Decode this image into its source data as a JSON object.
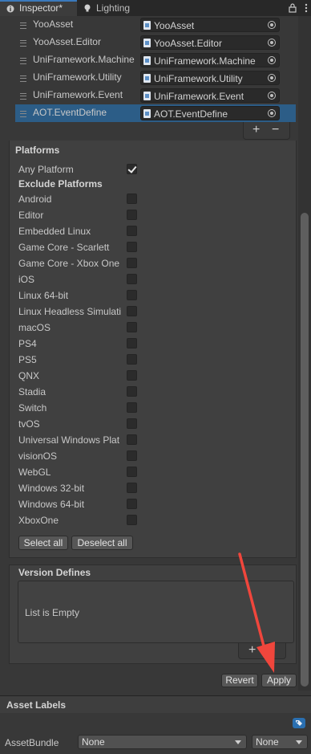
{
  "tabs": [
    {
      "label": "Inspector*",
      "icon": "info-icon",
      "active": true
    },
    {
      "label": "Lighting",
      "icon": "lightbulb-icon",
      "active": false
    }
  ],
  "tab_icons": [
    "lock-icon",
    "kebab-menu-icon"
  ],
  "references": [
    {
      "label": "YooAsset",
      "value": "YooAsset"
    },
    {
      "label": "YooAsset.Editor",
      "value": "YooAsset.Editor"
    },
    {
      "label": "UniFramework.Machine",
      "value": "UniFramework.Machine"
    },
    {
      "label": "UniFramework.Utility",
      "value": "UniFramework.Utility"
    },
    {
      "label": "UniFramework.Event",
      "value": "UniFramework.Event"
    },
    {
      "label": "AOT.EventDefine",
      "value": "AOT.EventDefine",
      "selected": true
    }
  ],
  "list_controls": {
    "add": "+",
    "remove": "−"
  },
  "platforms": {
    "title": "Platforms",
    "any_platform": {
      "label": "Any Platform",
      "checked": true
    },
    "exclude_title": "Exclude Platforms",
    "items": [
      {
        "label": "Android",
        "checked": false
      },
      {
        "label": "Editor",
        "checked": false
      },
      {
        "label": "Embedded Linux",
        "checked": false
      },
      {
        "label": "Game Core - Scarlett",
        "checked": false
      },
      {
        "label": "Game Core - Xbox One",
        "checked": false
      },
      {
        "label": "iOS",
        "checked": false
      },
      {
        "label": "Linux 64-bit",
        "checked": false
      },
      {
        "label": "Linux Headless Simulati",
        "checked": false
      },
      {
        "label": "macOS",
        "checked": false
      },
      {
        "label": "PS4",
        "checked": false
      },
      {
        "label": "PS5",
        "checked": false
      },
      {
        "label": "QNX",
        "checked": false
      },
      {
        "label": "Stadia",
        "checked": false
      },
      {
        "label": "Switch",
        "checked": false
      },
      {
        "label": "tvOS",
        "checked": false
      },
      {
        "label": "Universal Windows Plat",
        "checked": false
      },
      {
        "label": "visionOS",
        "checked": false
      },
      {
        "label": "WebGL",
        "checked": false
      },
      {
        "label": "Windows 32-bit",
        "checked": false
      },
      {
        "label": "Windows 64-bit",
        "checked": false
      },
      {
        "label": "XboxOne",
        "checked": false
      }
    ],
    "select_all": "Select all",
    "deselect_all": "Deselect all"
  },
  "version_defines": {
    "title": "Version Defines",
    "empty_text": "List is Empty",
    "add": "+",
    "remove": "−"
  },
  "actions": {
    "revert": "Revert",
    "apply": "Apply"
  },
  "asset_labels": {
    "title": "Asset Labels",
    "row_label": "AssetBundle",
    "bundle_value": "None",
    "variant_value": "None"
  },
  "colors": {
    "accent": "#3a79bb",
    "selection": "#2c5d87",
    "annotation_arrow": "#f0463c"
  }
}
